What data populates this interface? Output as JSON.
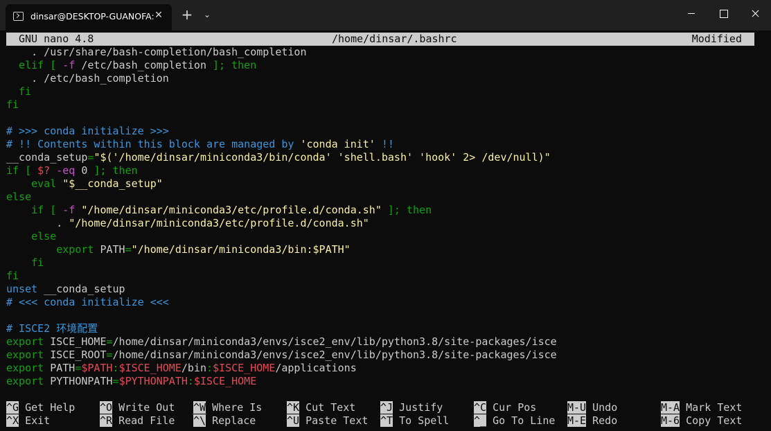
{
  "window": {
    "tab_title": "dinsar@DESKTOP-GUANOFA:",
    "tab_close_glyph": "✕",
    "new_tab_glyph": "+",
    "tab_menu_glyph": "⌄",
    "icons": [
      "terminal-icon",
      "close-icon",
      "plus-icon",
      "chevron-down-icon",
      "minimize-icon",
      "maximize-icon",
      "close-window-icon"
    ]
  },
  "nano": {
    "version": "GNU nano 4.8",
    "filename": "/home/dinsar/.bashrc",
    "status": "Modified"
  },
  "colors": {
    "background": "#0c0c0c",
    "default_text": "#cccccc",
    "keyword_green": "#13a10e",
    "operator_magenta": "#c94ccb",
    "string_yellow": "#f9f1a5",
    "comment_blue": "#3a96dd",
    "variable_red": "#e74856"
  },
  "buffer": [
    [
      {
        "t": "    . /usr/share/bash-completion/bash_completion",
        "c": "default"
      }
    ],
    [
      {
        "t": "  elif ",
        "c": "green"
      },
      {
        "t": "[ ",
        "c": "green"
      },
      {
        "t": "-f",
        "c": "magenta"
      },
      {
        "t": " /etc/bash_completion ",
        "c": "default"
      },
      {
        "t": "]; then",
        "c": "green"
      }
    ],
    [
      {
        "t": "    . /etc/bash_completion",
        "c": "default"
      }
    ],
    [
      {
        "t": "  fi",
        "c": "green"
      }
    ],
    [
      {
        "t": "fi",
        "c": "green"
      }
    ],
    [
      {
        "t": "",
        "c": "default"
      }
    ],
    [
      {
        "t": "# >>> conda initialize >>>",
        "c": "blue"
      }
    ],
    [
      {
        "t": "# !! Contents within this block are managed by ",
        "c": "blue"
      },
      {
        "t": "'conda init'",
        "c": "yellow"
      },
      {
        "t": " !!",
        "c": "blue"
      }
    ],
    [
      {
        "t": "__conda_setup",
        "c": "default"
      },
      {
        "t": "=",
        "c": "green"
      },
      {
        "t": "\"$(",
        "c": "yellow"
      },
      {
        "t": "'/home/dinsar/miniconda3/bin/conda' 'shell.bash' 'hook' 2> /dev/null)\"",
        "c": "yellow"
      }
    ],
    [
      {
        "t": "if [ ",
        "c": "green"
      },
      {
        "t": "$?",
        "c": "red"
      },
      {
        "t": " ",
        "c": "default"
      },
      {
        "t": "-eq",
        "c": "magenta"
      },
      {
        "t": " 0 ",
        "c": "default"
      },
      {
        "t": "]; then",
        "c": "green"
      }
    ],
    [
      {
        "t": "    eval ",
        "c": "green"
      },
      {
        "t": "\"$__conda_setup\"",
        "c": "yellow"
      }
    ],
    [
      {
        "t": "else",
        "c": "green"
      }
    ],
    [
      {
        "t": "    if [ ",
        "c": "green"
      },
      {
        "t": "-f",
        "c": "magenta"
      },
      {
        "t": " ",
        "c": "default"
      },
      {
        "t": "\"/home/dinsar/miniconda3/etc/profile.d/conda.sh\"",
        "c": "yellow"
      },
      {
        "t": " ]; then",
        "c": "green"
      }
    ],
    [
      {
        "t": "        . ",
        "c": "default"
      },
      {
        "t": "\"/home/dinsar/miniconda3/etc/profile.d/conda.sh\"",
        "c": "yellow"
      }
    ],
    [
      {
        "t": "    else",
        "c": "green"
      }
    ],
    [
      {
        "t": "        export ",
        "c": "green"
      },
      {
        "t": "PATH",
        "c": "default"
      },
      {
        "t": "=",
        "c": "green"
      },
      {
        "t": "\"/home/dinsar/miniconda3/bin:$PATH\"",
        "c": "yellow"
      }
    ],
    [
      {
        "t": "    fi",
        "c": "green"
      }
    ],
    [
      {
        "t": "fi",
        "c": "green"
      }
    ],
    [
      {
        "t": "unset ",
        "c": "blue"
      },
      {
        "t": "__conda_setup",
        "c": "default"
      }
    ],
    [
      {
        "t": "# <<< conda initialize <<<",
        "c": "blue"
      }
    ],
    [
      {
        "t": "",
        "c": "default"
      }
    ],
    [
      {
        "t": "# ISCE2 环境配置",
        "c": "blue"
      }
    ],
    [
      {
        "t": "export ",
        "c": "green"
      },
      {
        "t": "ISCE_HOME",
        "c": "default"
      },
      {
        "t": "=",
        "c": "green"
      },
      {
        "t": "/home/dinsar/miniconda3/envs/isce2_env/lib/python3.8/site-packages/isce",
        "c": "default"
      }
    ],
    [
      {
        "t": "export ",
        "c": "green"
      },
      {
        "t": "ISCE_ROOT",
        "c": "default"
      },
      {
        "t": "=",
        "c": "green"
      },
      {
        "t": "/home/dinsar/miniconda3/envs/isce2_env/lib/python3.8/site-packages/isce",
        "c": "default"
      }
    ],
    [
      {
        "t": "export ",
        "c": "green"
      },
      {
        "t": "PATH",
        "c": "default"
      },
      {
        "t": "=",
        "c": "green"
      },
      {
        "t": "$PATH",
        "c": "red"
      },
      {
        "t": ":",
        "c": "green"
      },
      {
        "t": "$ISCE_HOME",
        "c": "red"
      },
      {
        "t": "/bin",
        "c": "default"
      },
      {
        "t": ":",
        "c": "green"
      },
      {
        "t": "$ISCE_HOME",
        "c": "red"
      },
      {
        "t": "/applications",
        "c": "default"
      }
    ],
    [
      {
        "t": "export ",
        "c": "green"
      },
      {
        "t": "PYTHONPATH",
        "c": "default"
      },
      {
        "t": "=",
        "c": "green"
      },
      {
        "t": "$PYTHONPATH",
        "c": "red"
      },
      {
        "t": ":",
        "c": "green"
      },
      {
        "t": "$ISCE_HOME",
        "c": "red"
      }
    ]
  ],
  "shortcuts": [
    {
      "key": "^G",
      "label": "Get Help",
      "name": "get-help"
    },
    {
      "key": "^X",
      "label": "Exit",
      "name": "exit"
    },
    {
      "key": "^O",
      "label": "Write Out",
      "name": "write-out"
    },
    {
      "key": "^R",
      "label": "Read File",
      "name": "read-file"
    },
    {
      "key": "^W",
      "label": "Where Is",
      "name": "where-is"
    },
    {
      "key": "^\\",
      "label": "Replace",
      "name": "replace"
    },
    {
      "key": "^K",
      "label": "Cut Text",
      "name": "cut-text"
    },
    {
      "key": "^U",
      "label": "Paste Text",
      "name": "paste-text"
    },
    {
      "key": "^J",
      "label": "Justify",
      "name": "justify"
    },
    {
      "key": "^T",
      "label": "To Spell",
      "name": "to-spell"
    },
    {
      "key": "^C",
      "label": "Cur Pos",
      "name": "cur-pos"
    },
    {
      "key": "^_",
      "label": "Go To Line",
      "name": "go-to-line"
    },
    {
      "key": "M-U",
      "label": "Undo",
      "name": "undo"
    },
    {
      "key": "M-E",
      "label": "Redo",
      "name": "redo"
    },
    {
      "key": "M-A",
      "label": "Mark Text",
      "name": "mark-text"
    },
    {
      "key": "M-6",
      "label": "Copy Text",
      "name": "copy-text"
    }
  ]
}
